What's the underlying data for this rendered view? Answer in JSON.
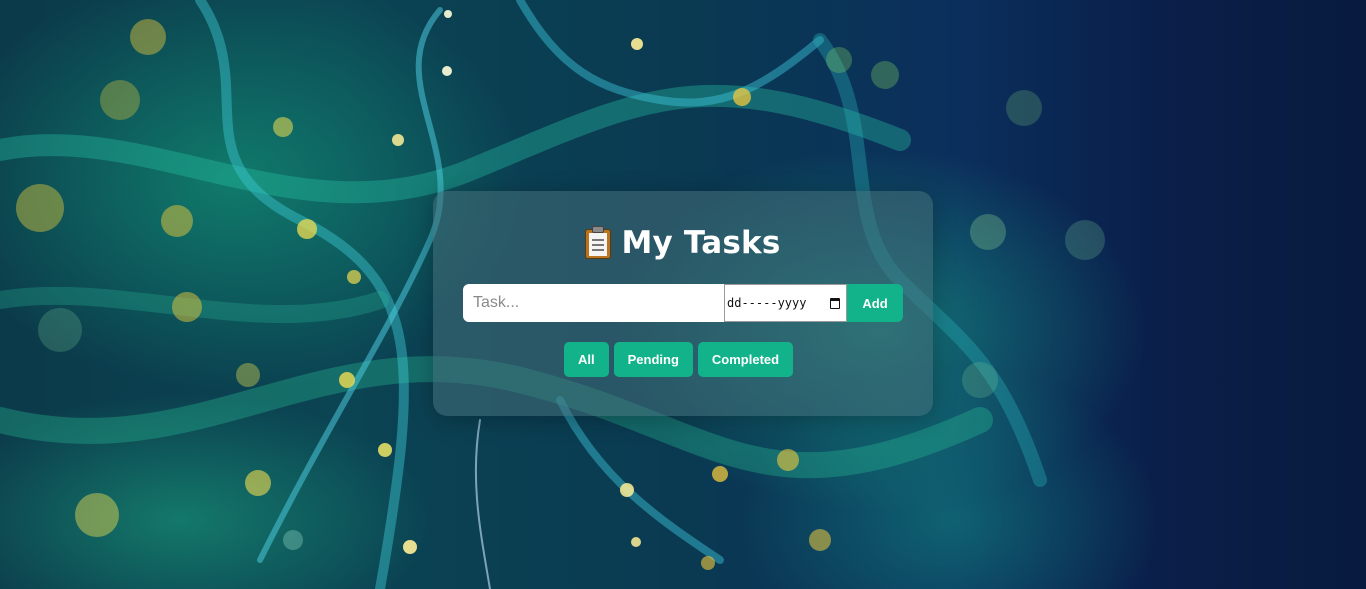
{
  "app": {
    "title": "My Tasks",
    "title_icon": "clipboard-icon"
  },
  "form": {
    "task_placeholder": "Task...",
    "task_value": "",
    "date_placeholder": "dd-----yyyy",
    "date_icon": "calendar-icon",
    "add_label": "Add"
  },
  "filters": [
    {
      "label": "All"
    },
    {
      "label": "Pending"
    },
    {
      "label": "Completed"
    }
  ],
  "colors": {
    "accent": "#12b38b",
    "card": "rgba(70,110,120,0.55)",
    "background_dark": "#081a3e",
    "background_teal": "#0b4453"
  }
}
